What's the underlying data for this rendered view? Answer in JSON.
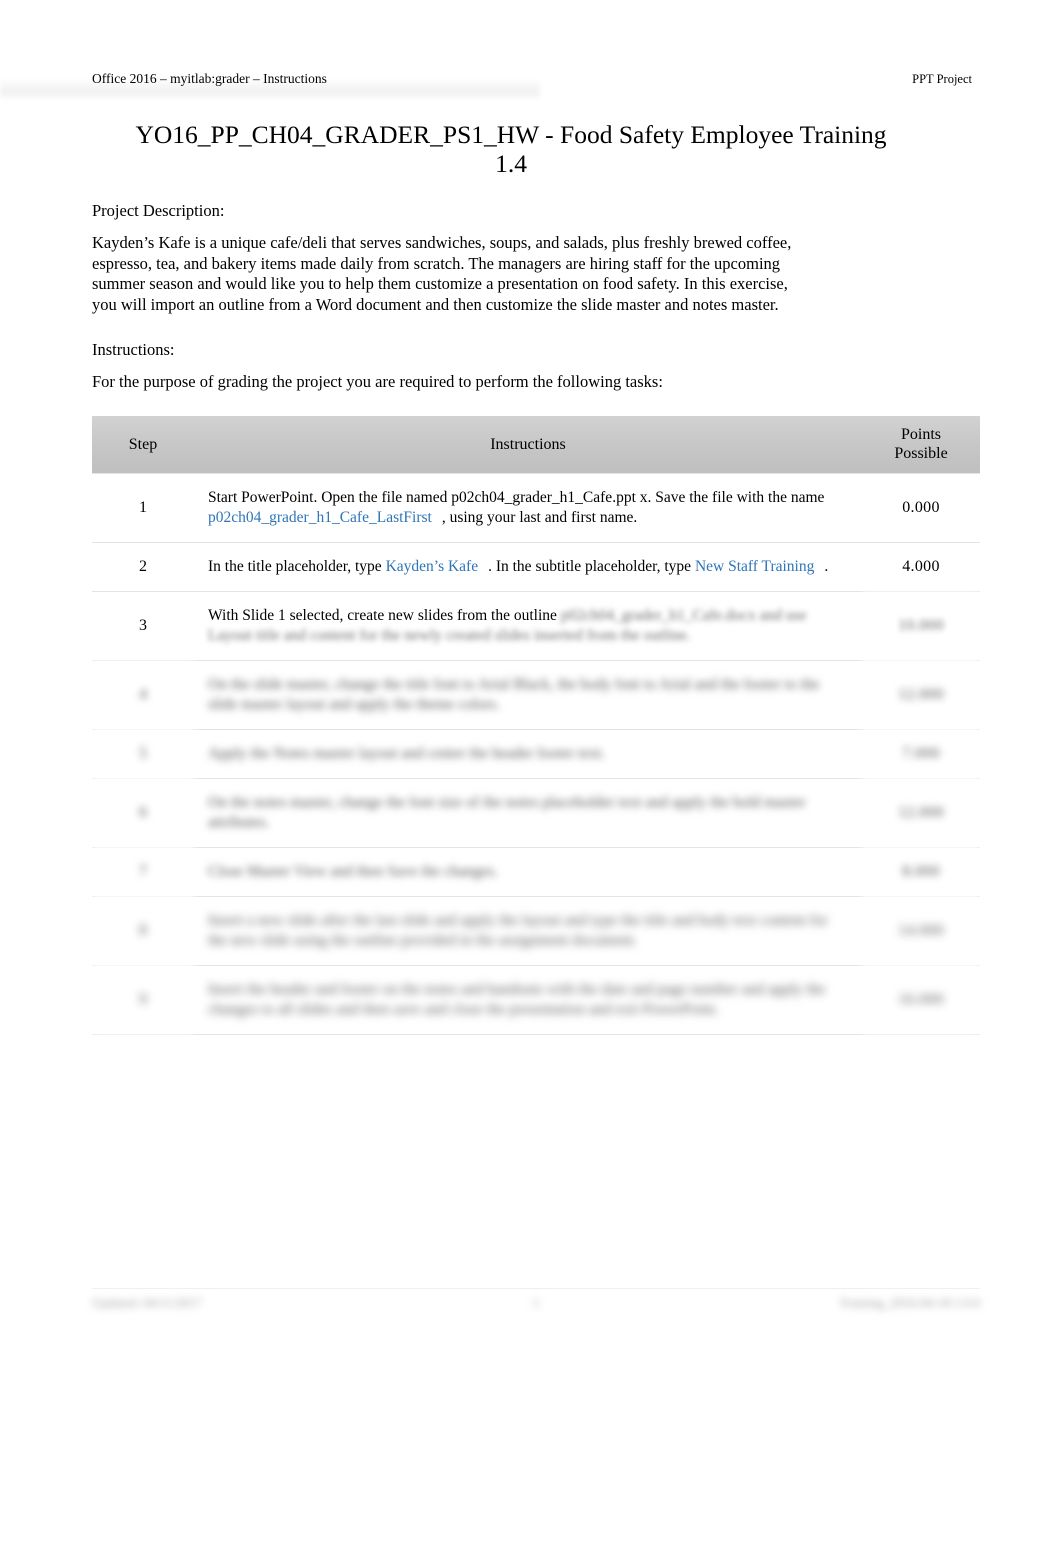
{
  "header": {
    "left": "Office 2016 – myitlab:grader – Instructions",
    "right": "PPT Project"
  },
  "title": "YO16_PP_CH04_GRADER_PS1_HW - Food Safety Employee Training 1.4",
  "sections": {
    "project_description_label": "Project Description:",
    "project_description_body": "Kayden’s Kafe is a unique cafe/deli that serves sandwiches, soups, and salads, plus freshly brewed coffee, espresso, tea, and bakery items made daily from scratch. The managers are hiring staff for the upcoming summer season and would like you to help them customize a presentation on food safety. In this exercise, you will import an outline from a Word document and then customize the slide master and notes master.",
    "instructions_label": "Instructions:",
    "instructions_intro": "For the purpose of grading the project you are required to perform the following tasks:"
  },
  "table": {
    "columns": {
      "step": "Step",
      "instructions": "Instructions",
      "points": "Points\nPossible",
      "points_line1": "Points",
      "points_line2": "Possible"
    },
    "rows": [
      {
        "step": "1",
        "points": "0.000",
        "instr_part1": "Start PowerPoint. Open the file named p02ch04_grader_h1_Cafe.ppt x. Save the file with the name",
        "instr_link": "p02ch04_grader_h1_Cafe_LastFirst",
        "instr_part2": ", using your last and first name.",
        "legible": true
      },
      {
        "step": "2",
        "points": "4.000",
        "instr_part1": "In the title placeholder, type",
        "instr_link": "Kayden’s Kafe",
        "instr_part2": ". In the subtitle placeholder, type",
        "instr_link2": "New Staff Training",
        "instr_part3": ".",
        "legible": true
      },
      {
        "step": "3",
        "points": "10.000",
        "instr_part1": "With Slide 1 selected, create new slides from the outline",
        "instr_redacted_1": "p02ch04_grader_h1_Cafe.docx and use Layout title",
        "instr_redacted_2": "and content for the newly created slides inserted from the outline.",
        "legible": "partial"
      },
      {
        "step": "4",
        "points": "12.000",
        "instr_redacted_1": "On the slide master, change the title font to Arial Black, the body font to Arial and the footer to",
        "instr_redacted_2": "the slide master layout and apply the theme colors.",
        "legible": false
      },
      {
        "step": "5",
        "points": "7.000",
        "instr_redacted_1": "Apply the Notes master layout and center the header footer text.",
        "legible": false
      },
      {
        "step": "6",
        "points": "12.000",
        "instr_redacted_1": "On the notes master, change the font size of the notes placeholder text and apply the bold",
        "instr_redacted_2": "master attributes.",
        "legible": false
      },
      {
        "step": "7",
        "points": "8.000",
        "instr_redacted_1": "Close Master View and then Save the changes.",
        "legible": false
      },
      {
        "step": "8",
        "points": "14.000",
        "instr_redacted_1": "Insert a new slide after the last slide and apply the layout and type the title and body text",
        "instr_redacted_2": "content for the new slide using the outline provided in the assignment document.",
        "legible": false
      },
      {
        "step": "9",
        "points": "16.000",
        "instr_redacted_1": "Insert the header and footer on the notes and handouts with the date and page number and",
        "instr_redacted_2": "apply the changes to all slides and then save and close the presentation and exit PowerPoint.",
        "legible": false
      }
    ]
  },
  "footer": {
    "left": "Updated: 04/11/2017",
    "center": "1",
    "right": "Training_2016-04-18 1.0.0"
  }
}
